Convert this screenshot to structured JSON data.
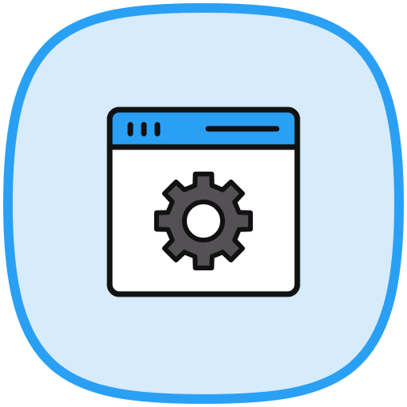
{
  "icon": {
    "name": "browser-settings-icon",
    "badge_background": "#d6ebfb",
    "badge_border": "#2aa0f5",
    "window_fill": "#ffffff",
    "window_header": "#2aa0f5",
    "outline": "#111111",
    "gear_fill": "#545155",
    "gear_hole": "#ffffff",
    "header_dots": 3
  }
}
